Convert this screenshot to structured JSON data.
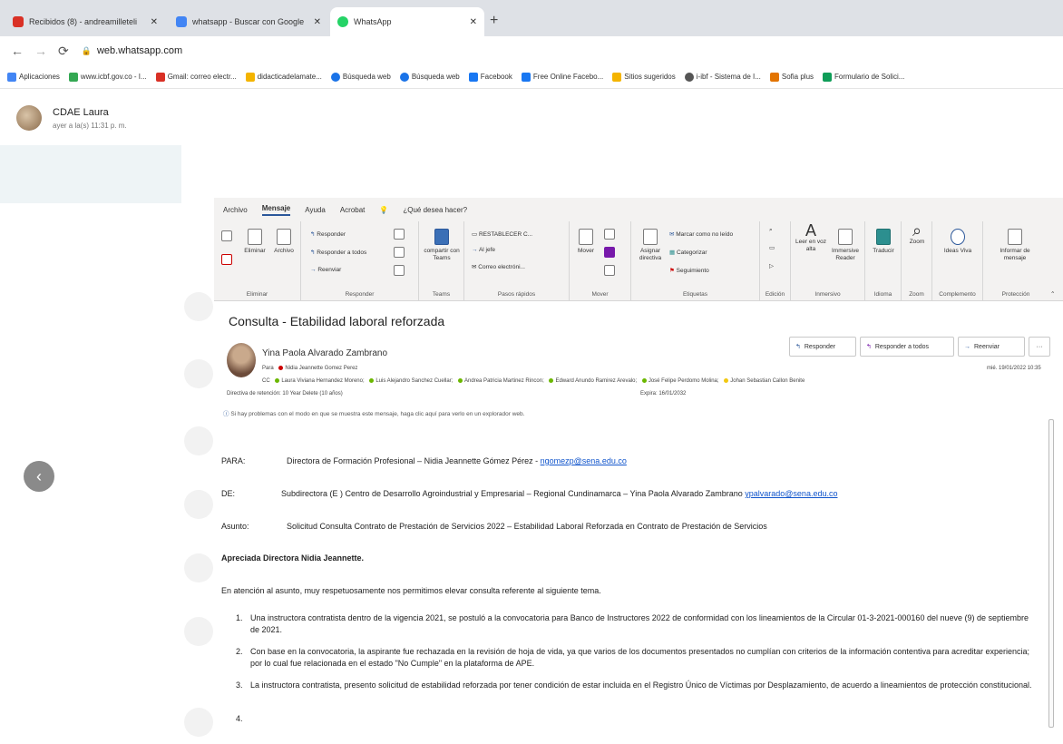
{
  "browser": {
    "tabs": [
      {
        "label": "Recibidos (8) - andreamilleteli",
        "icon_color": "#d93025"
      },
      {
        "label": "whatsapp - Buscar con Google",
        "icon_color": "#4285f4"
      },
      {
        "label": "WhatsApp",
        "icon_color": "#25d366"
      }
    ],
    "url": "web.whatsapp.com",
    "bookmarks": [
      {
        "label": "Aplicaciones",
        "color": "#4285f4"
      },
      {
        "label": "www.icbf.gov.co - I...",
        "color": "#34a853"
      },
      {
        "label": "Gmail: correo electr...",
        "color": "#d93025"
      },
      {
        "label": "didacticadelamate...",
        "color": "#f4b400"
      },
      {
        "label": "Búsqueda web",
        "color": "#1a73e8"
      },
      {
        "label": "Búsqueda web",
        "color": "#1a73e8"
      },
      {
        "label": "Facebook",
        "color": "#1877f2"
      },
      {
        "label": "Free Online Facebo...",
        "color": "#1877f2"
      },
      {
        "label": "Sitios sugeridos",
        "color": "#f4b400"
      },
      {
        "label": "i-ibf - Sistema de I...",
        "color": "#555555"
      },
      {
        "label": "Sofia plus",
        "color": "#e37400"
      },
      {
        "label": "Formulario de Solici...",
        "color": "#0f9d58"
      }
    ]
  },
  "whatsapp": {
    "contact_name": "CDAE Laura",
    "contact_status": "ayer a la(s) 11:31 p. m."
  },
  "outlook": {
    "menu": [
      "Archivo",
      "Mensaje",
      "Ayuda",
      "Acrobat",
      "¿Qué desea hacer?"
    ],
    "ribbon": {
      "eliminar": {
        "label": "Eliminar",
        "btn_delete": "Eliminar",
        "btn_archive": "Archivo"
      },
      "responder": {
        "label": "Responder",
        "reply": "Responder",
        "reply_all": "Responder a todos",
        "forward": "Reenviar"
      },
      "teams": {
        "label": "Teams",
        "share": "compartir con Teams"
      },
      "pasos": {
        "label": "Pasos rápidos",
        "restablecer": "RESTABLECER C...",
        "jefe": "Al jefe",
        "correo": "Correo electróni..."
      },
      "mover": {
        "label": "Mover",
        "mover": "Mover"
      },
      "etiquetas": {
        "label": "Etiquetas",
        "asignar": "Asignar directiva",
        "marcar": "Marcar como no leído",
        "categorizar": "Categorizar",
        "seguimiento": "Seguimiento"
      },
      "edicion": {
        "label": "Edición"
      },
      "inmersivo": {
        "label": "Inmersivo",
        "leer": "Leer en voz alta",
        "reader": "Immersive Reader"
      },
      "idioma": {
        "label": "Idioma",
        "traducir": "Traducir"
      },
      "zoom": {
        "label": "Zoom",
        "zoom": "Zoom"
      },
      "complemento": {
        "label": "Complemento",
        "ideas": "Ideas Viva"
      },
      "proteccion": {
        "label": "Protección",
        "informar": "Informar de mensaje"
      }
    },
    "subject": "Consulta - Etabilidad laboral reforzada",
    "sender": "Yina Paola Alvarado Zambrano",
    "to_label": "Para",
    "to": "Nidia Jeannette Gomez Perez",
    "cc_label": "CC",
    "cc": [
      {
        "name": "Laura Viviana Hernandez Moreno",
        "color": "#6bb700"
      },
      {
        "name": "Luis Alejandro Sanchez Cuellar",
        "color": "#6bb700"
      },
      {
        "name": "Andrea Patricia Martinez Rincon",
        "color": "#6bb700"
      },
      {
        "name": "Edward Anundo Ramirez Arevalo",
        "color": "#6bb700"
      },
      {
        "name": "José Felipe Perdomo Molina",
        "color": "#6bb700"
      },
      {
        "name": "Johan Sebastian Callon Benite",
        "color": "#f2c811"
      }
    ],
    "retention": "Directiva de retención: 10 Year Delete (10 años)",
    "expires": "Expira: 16/01/2032",
    "date": "mié. 19/01/2022 10:35",
    "actions": {
      "reply": "Responder",
      "reply_all": "Responder a todos",
      "forward": "Reenviar",
      "more": "···"
    },
    "info_bar": "Si hay problemas con el modo en que se muestra este mensaje, haga clic aquí para verlo en un explorador web.",
    "body": {
      "para_label": "PARA:",
      "para_value": "Directora de Formación Profesional – Nidia Jeannette Gómez Pérez - ",
      "para_email": "ngomezp@sena.edu.co",
      "de_label": "DE:",
      "de_value": "Subdirectora (E ) Centro de Desarrollo Agroindustrial y Empresarial – Regional Cundinamarca – Yina Paola Alvarado Zambrano ",
      "de_email": "ypalvarado@sena.edu.co",
      "asunto_label": "Asunto:",
      "asunto_value": "Solicitud Consulta Contrato de Prestación de Servicios 2022 – Estabilidad Laboral Reforzada en Contrato de Prestación de Servicios",
      "greeting": "Apreciada Directora Nidia Jeannette.",
      "intro": "En atención al asunto, muy respetuosamente nos permitimos elevar consulta referente al siguiente tema.",
      "items": [
        {
          "n": "1.",
          "text": "Una instructora contratista dentro de la vigencia 2021, se postuló a la convocatoria para Banco de Instructores 2022 de conformidad con los lineamientos de la Circular  01-3-2021-000160 del nueve (9) de septiembre de 2021."
        },
        {
          "n": "2.",
          "text": "Con base en la convocatoria, la aspirante fue rechazada en la revisión de hoja de vida, ya que varios de los documentos presentados no cumplían con criterios de la información contentiva para acreditar experiencia; por lo cual fue relacionada en el estado \"No Cumple\" en la plataforma de APE."
        },
        {
          "n": "3.",
          "text": "La instructora contratista, presento solicitud de estabilidad reforzada por tener condición de estar incluida en el Registro Único de Víctimas por Desplazamiento, de acuerdo a lineamientos de protección constitucional."
        },
        {
          "n": "4.",
          "text": ""
        }
      ]
    }
  }
}
